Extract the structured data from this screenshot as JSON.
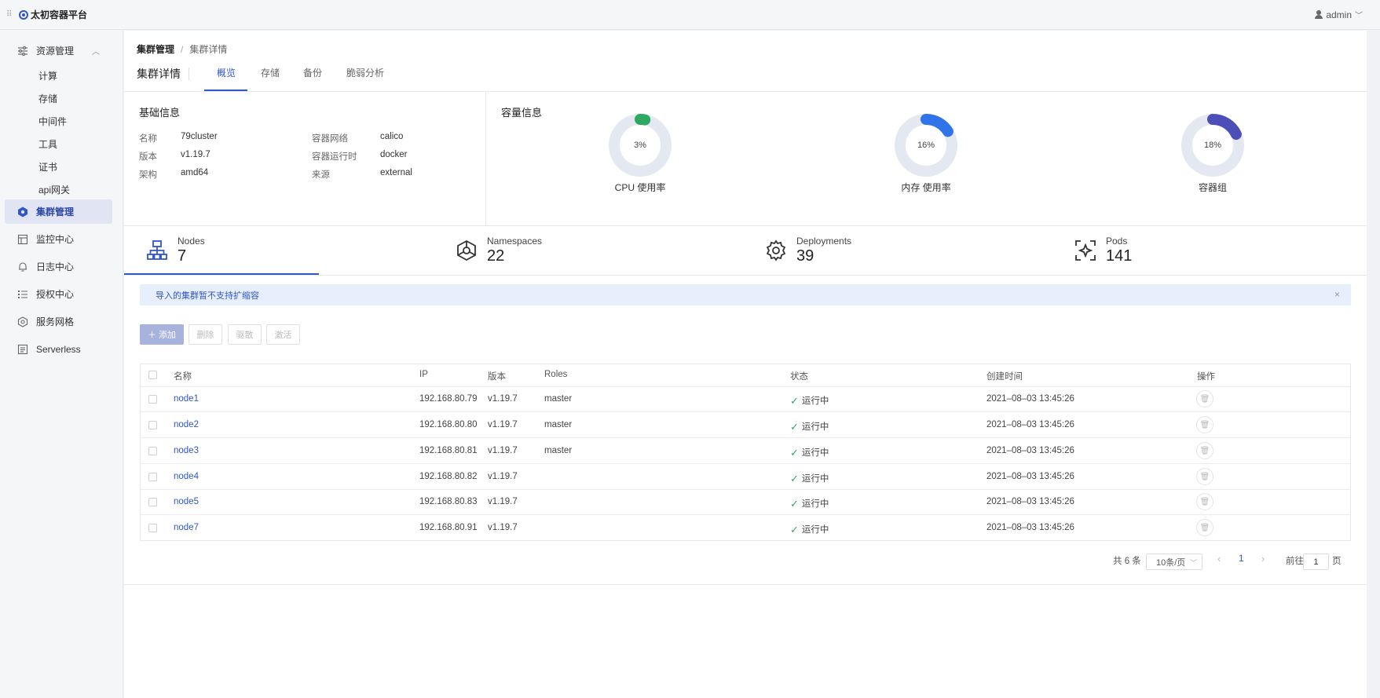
{
  "app": {
    "title": "太初容器平台",
    "user": "admin"
  },
  "sidebar": {
    "resource_mgmt": "资源管理",
    "sub_items": [
      "计算",
      "存储",
      "中间件",
      "工具",
      "证书",
      "api网关"
    ],
    "items": [
      "集群管理",
      "监控中心",
      "日志中心",
      "授权中心",
      "服务网格",
      "Serverless"
    ]
  },
  "breadcrumb": {
    "parent": "集群管理",
    "sep": "/",
    "current": "集群详情"
  },
  "page_title": "集群详情",
  "tabs": [
    "概览",
    "存储",
    "备份",
    "脆弱分析"
  ],
  "basic_info": {
    "title": "基础信息",
    "rows": [
      {
        "label": "名称",
        "value": "79cluster"
      },
      {
        "label": "版本",
        "value": "v1.19.7"
      },
      {
        "label": "架构",
        "value": "amd64"
      },
      {
        "label": "容器网络",
        "value": "calico"
      },
      {
        "label": "容器运行时",
        "value": "docker"
      },
      {
        "label": "来源",
        "value": "external"
      }
    ]
  },
  "capacity": {
    "title": "容量信息",
    "items": [
      {
        "label": "CPU 使用率",
        "pct_text": "3%",
        "fraction": 0.03,
        "color": "#2fa864"
      },
      {
        "label": "内存 使用率",
        "pct_text": "16%",
        "fraction": 0.16,
        "color": "#2f74e8"
      },
      {
        "label": "容器组",
        "pct_text": "18%",
        "fraction": 0.18,
        "color": "#4d4fb8"
      }
    ]
  },
  "stats": [
    {
      "label": "Nodes",
      "value": "7",
      "icon": "nodes-icon"
    },
    {
      "label": "Namespaces",
      "value": "22",
      "icon": "namespaces-icon"
    },
    {
      "label": "Deployments",
      "value": "39",
      "icon": "deployments-icon"
    },
    {
      "label": "Pods",
      "value": "141",
      "icon": "pods-icon"
    }
  ],
  "alert": {
    "text": "导入的集群暂不支持扩缩容",
    "close": "×"
  },
  "toolbar": {
    "add": "＋ 添加",
    "delete": "删除",
    "drain": "驱散",
    "activate": "激活"
  },
  "table": {
    "headers": [
      "名称",
      "IP",
      "版本",
      "Roles",
      "状态",
      "创建时间",
      "操作"
    ],
    "rows": [
      {
        "name": "node1",
        "ip": "192.168.80.79",
        "version": "v1.19.7",
        "role": "master",
        "status": "运行中",
        "created": "2021–08–03 13:45:26"
      },
      {
        "name": "node2",
        "ip": "192.168.80.80",
        "version": "v1.19.7",
        "role": "master",
        "status": "运行中",
        "created": "2021–08–03 13:45:26"
      },
      {
        "name": "node3",
        "ip": "192.168.80.81",
        "version": "v1.19.7",
        "role": "master",
        "status": "运行中",
        "created": "2021–08–03 13:45:26"
      },
      {
        "name": "node4",
        "ip": "192.168.80.82",
        "version": "v1.19.7",
        "role": "",
        "status": "运行中",
        "created": "2021–08–03 13:45:26"
      },
      {
        "name": "node5",
        "ip": "192.168.80.83",
        "version": "v1.19.7",
        "role": "",
        "status": "运行中",
        "created": "2021–08–03 13:45:26"
      },
      {
        "name": "node7",
        "ip": "192.168.80.91",
        "version": "v1.19.7",
        "role": "",
        "status": "运行中",
        "created": "2021–08–03 13:45:26"
      }
    ]
  },
  "pagination": {
    "total": "共 6 条",
    "page_size": "10条/页",
    "prev": "‹",
    "page": "1",
    "next": "›",
    "goto": "前往",
    "goto_value": "1",
    "page_unit": "页"
  },
  "colors": {
    "accent": "#3056c8",
    "success": "#2fa864",
    "ring_track": "#e4e8f1"
  }
}
